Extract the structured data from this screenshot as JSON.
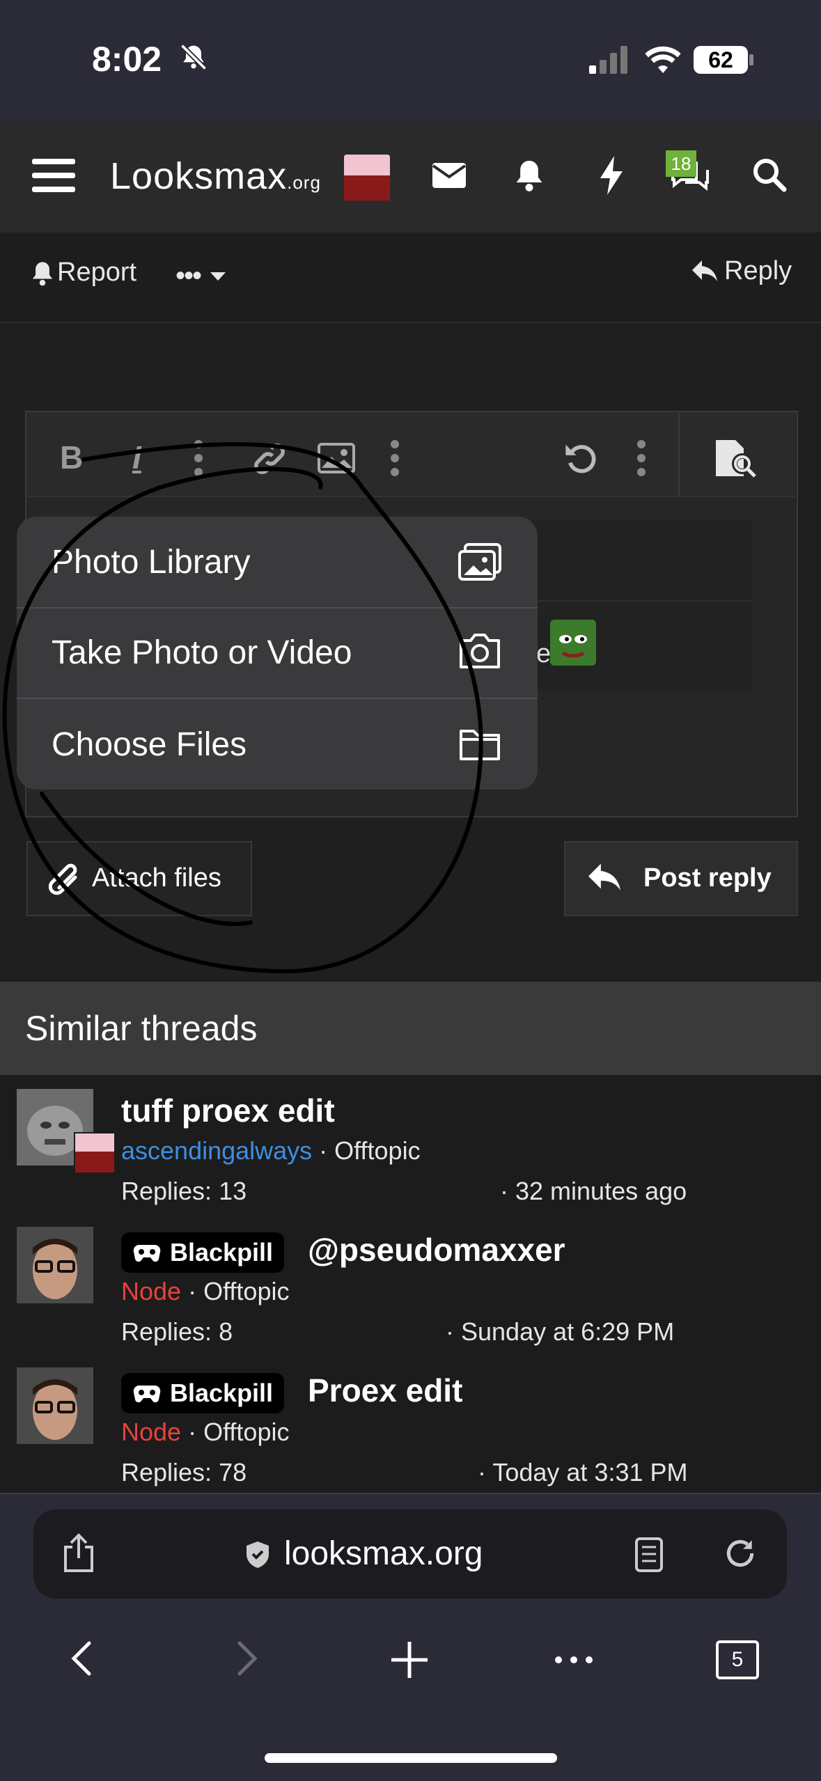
{
  "status": {
    "time": "8:02",
    "battery": "62"
  },
  "nav": {
    "logo_main": "Looksmax",
    "logo_suffix": ".org",
    "chat_badge": "18"
  },
  "actions": {
    "report": "Report",
    "reply": "Reply"
  },
  "popup": {
    "items": [
      {
        "label": "Photo Library",
        "icon": "photos-icon"
      },
      {
        "label": "Take Photo or Video",
        "icon": "camera-icon"
      },
      {
        "label": "Choose Files",
        "icon": "folder-icon"
      }
    ]
  },
  "editor": {
    "partial_text": "e"
  },
  "buttons": {
    "attach": "Attach files",
    "post": "Post reply"
  },
  "similar": {
    "title": "Similar threads",
    "threads": [
      {
        "title": "tuff proex edit",
        "author": "ascendingalways",
        "author_color": "#3d8fe0",
        "forum": "Offtopic",
        "replies": "Replies: 13",
        "time": "· 32 minutes ago",
        "badge": ""
      },
      {
        "title": "@pseudomaxxer",
        "author": "Node",
        "author_color": "#e8423b",
        "forum": "Offtopic",
        "replies": "Replies: 8",
        "time": "· Sunday at 6:29 PM",
        "badge": "Blackpill"
      },
      {
        "title": "Proex edit",
        "author": "Node",
        "author_color": "#e8423b",
        "forum": "Offtopic",
        "replies": "Replies: 78",
        "time": "· Today at 3:31 PM",
        "badge": "Blackpill"
      }
    ]
  },
  "browser": {
    "url": "looksmax.org",
    "tabs_count": "5"
  }
}
